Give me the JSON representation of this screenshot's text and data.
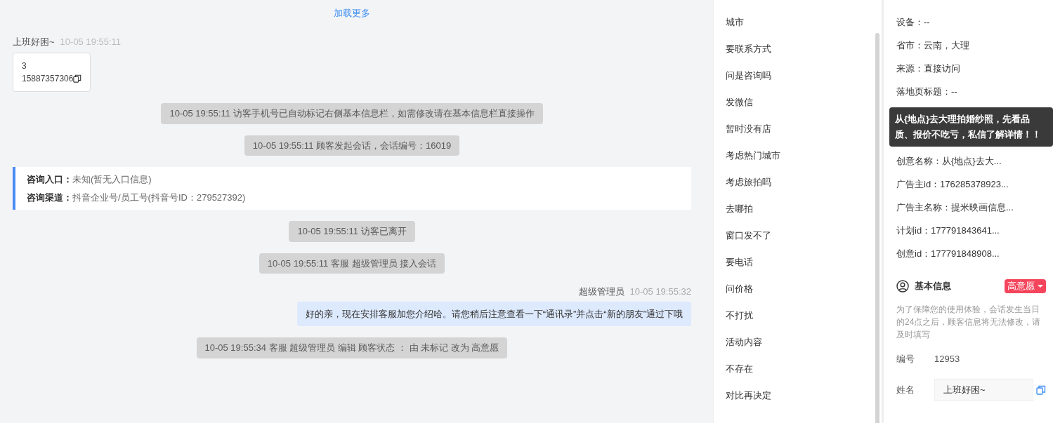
{
  "chat": {
    "load_more": "加载更多",
    "visitor": {
      "name": "上班好困~",
      "time": "10-05 19:55:11",
      "card_lines": [
        "3",
        "15887357306"
      ]
    },
    "events": [
      {
        "kind": "system",
        "text": "10-05 19:55:11 访客手机号已自动标记右侧基本信息栏，如需修改请在基本信息栏直接操作"
      },
      {
        "kind": "system",
        "text": "10-05 19:55:11 顾客发起会话，会话编号：16019"
      },
      {
        "kind": "info",
        "rows": [
          {
            "label": "咨询入口：",
            "value": "未知(暂无入口信息)"
          },
          {
            "label": "咨询渠道：",
            "value": "抖音企业号/员工号(抖音号ID：279527392)"
          }
        ]
      },
      {
        "kind": "system",
        "text": "10-05 19:55:11 访客已离开"
      },
      {
        "kind": "system",
        "text": "10-05 19:55:11 客服 超级管理员 接入会话"
      },
      {
        "kind": "agent",
        "name": "超级管理员",
        "time": "10-05 19:55:32",
        "text": "好的亲，现在安排客服加您介绍哈。请您稍后注意查看一下“通讯录”并点击“新的朋友”通过下哦"
      },
      {
        "kind": "system",
        "text": "10-05 19:55:34 客服 超级管理员 编辑 顾客状态 ： 由 未标记 改为 高意愿"
      }
    ]
  },
  "tags": [
    "城市",
    "要联系方式",
    "问是咨询吗",
    "发微信",
    "暂时没有店",
    "考虑热门城市",
    "考虑旅拍吗",
    "去哪拍",
    "窗口发不了",
    "要电话",
    "问价格",
    "不打扰",
    "活动内容",
    "不存在",
    "对比再决定"
  ],
  "details": {
    "rows_before": [
      "设备：--",
      "省市：云南，大理",
      "来源：直接访问",
      "落地页标题：--"
    ],
    "tooltip": "从{地点}去大理拍婚纱照，先看品质、报价不吃亏，私信了解详情！！",
    "rows_after": [
      "创意名称：从{地点}去大...",
      "广告主id：176285378923...",
      "广告主名称：提米映画信息...",
      "计划id：177791843641...",
      "创意id：177791848908..."
    ]
  },
  "basic_info": {
    "title": "基本信息",
    "intent": "高意愿",
    "note": "为了保障您的使用体验，会话发生当日的24点之后，顾客信息将无法修改，请及时填写",
    "number_label": "编号",
    "number": "12953",
    "name_label": "姓名",
    "name_value": "上班好困~"
  }
}
